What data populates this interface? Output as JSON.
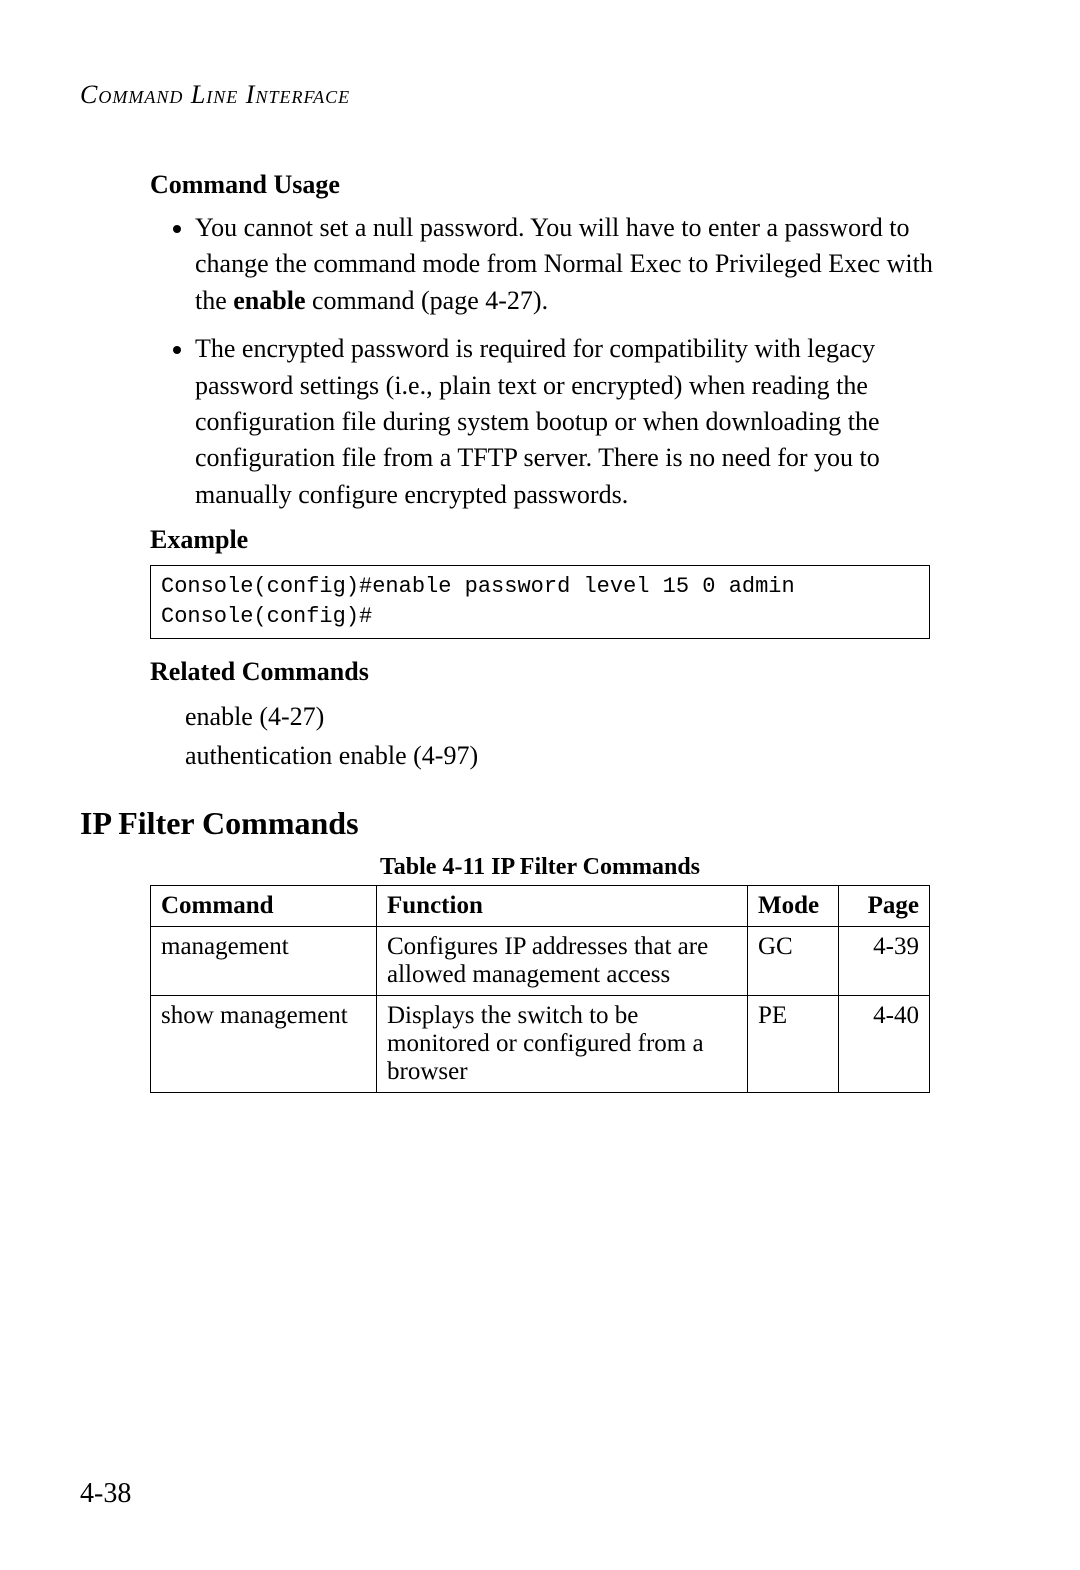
{
  "running_head": "Command Line Interface",
  "command_usage": {
    "heading": "Command Usage",
    "bullets": [
      {
        "pre": "You cannot set a null password. You will have to enter a password to change the command mode from Normal Exec to Privileged Exec with the ",
        "bold": "enable",
        "post": " command (page 4-27)."
      },
      {
        "pre": "The encrypted password is required for compatibility with legacy password settings (i.e., plain text or encrypted) when reading the configuration file during system bootup or when downloading the configuration file from a TFTP server. There is no need for you to manually configure encrypted passwords.",
        "bold": "",
        "post": ""
      }
    ]
  },
  "example": {
    "heading": "Example",
    "code": "Console(config)#enable password level 15 0 admin\nConsole(config)#"
  },
  "related": {
    "heading": "Related Commands",
    "items": [
      "enable (4-27)",
      "authentication enable (4-97)"
    ]
  },
  "ip_filter": {
    "heading": "IP Filter Commands",
    "table_caption": "Table 4-11  IP Filter Commands",
    "columns": [
      "Command",
      "Function",
      "Mode",
      "Page"
    ],
    "rows": [
      {
        "command": "management",
        "function": "Configures IP addresses that are allowed management access",
        "mode": "GC",
        "page": "4-39"
      },
      {
        "command": "show management",
        "function": "Displays the switch to be monitored or configured from a browser",
        "mode": "PE",
        "page": "4-40"
      }
    ]
  },
  "page_number": "4-38",
  "chart_data": {
    "type": "table",
    "title": "Table 4-11  IP Filter Commands",
    "columns": [
      "Command",
      "Function",
      "Mode",
      "Page"
    ],
    "rows": [
      [
        "management",
        "Configures IP addresses that are allowed management access",
        "GC",
        "4-39"
      ],
      [
        "show management",
        "Displays the switch to be monitored or configured from a browser",
        "PE",
        "4-40"
      ]
    ]
  }
}
